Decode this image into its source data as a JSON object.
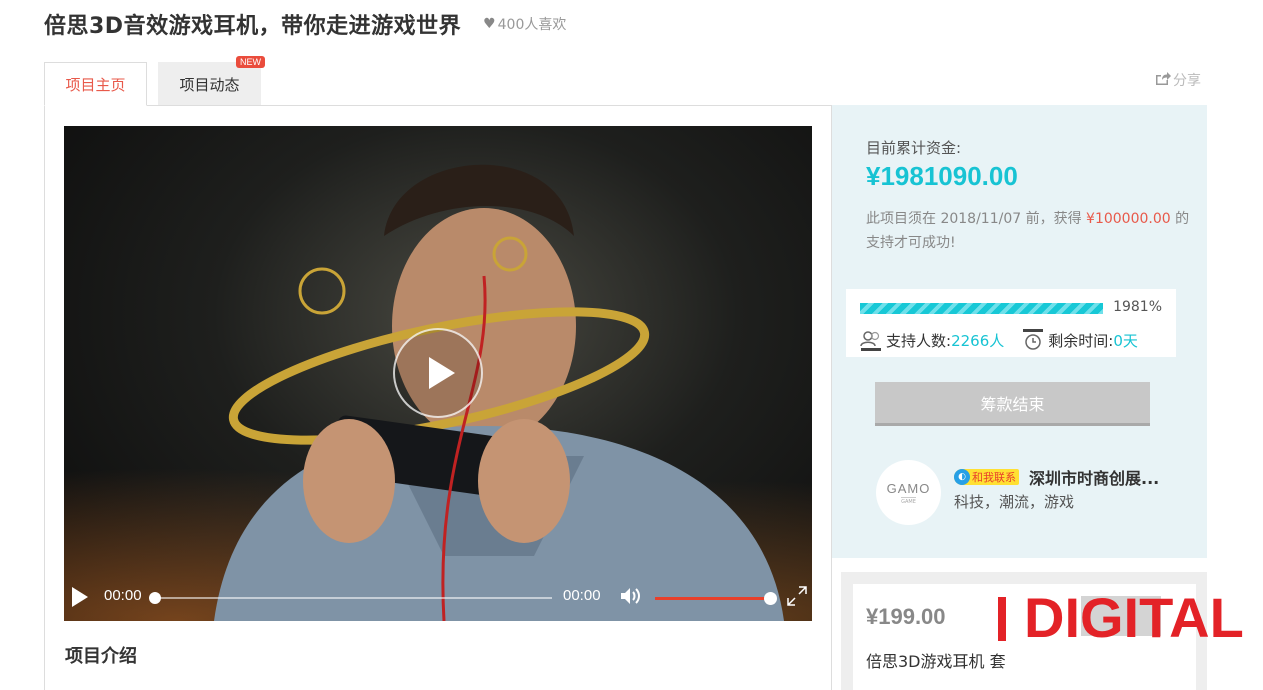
{
  "page": {
    "title": "倍思3D音效游戏耳机，带你走进游戏世界",
    "likes": "400人喜欢",
    "share_label": "分享"
  },
  "tabs": [
    {
      "label": "项目主页",
      "active": true
    },
    {
      "label": "项目动态",
      "active": false,
      "badge": "NEW"
    }
  ],
  "video": {
    "current_time": "00:00",
    "duration": "00:00",
    "progress": 0,
    "volume": 1.0
  },
  "main": {
    "section_title": "项目介绍"
  },
  "funding": {
    "raised_label": "目前累计资金:",
    "raised_amount": "¥1981090.00",
    "goal_prefix": "此项目须在 2018/11/07 前，获得 ",
    "goal_amount": "¥100000.00",
    "goal_suffix": " 的支持才可成功!",
    "percent": "1981%",
    "percent_value": 1981,
    "backers_label": "支持人数:",
    "backers_value": "2266人",
    "remaining_label": "剩余时间:",
    "remaining_value": "0天",
    "status_button": "筹款结束"
  },
  "organizer": {
    "logo_text": "GAMO",
    "logo_sub": "GAME",
    "badge": "和我联系",
    "name": "深圳市时商创展...",
    "tags": "科技，潮流，游戏"
  },
  "reward": {
    "price": "¥199.00",
    "name": "倍思3D游戏耳机  套"
  },
  "watermark": {
    "text": "DIGITAL",
    "color": "#e32227"
  },
  "colors": {
    "accent_cyan": "#17c3d3",
    "accent_red": "#e8594a",
    "side_bg": "#e8f3f6"
  },
  "icons": {
    "heart": "heart-icon",
    "share": "share-icon",
    "backers": "users-icon",
    "time": "clock-icon",
    "volume": "volume-icon",
    "fullscreen": "fullscreen-icon"
  }
}
